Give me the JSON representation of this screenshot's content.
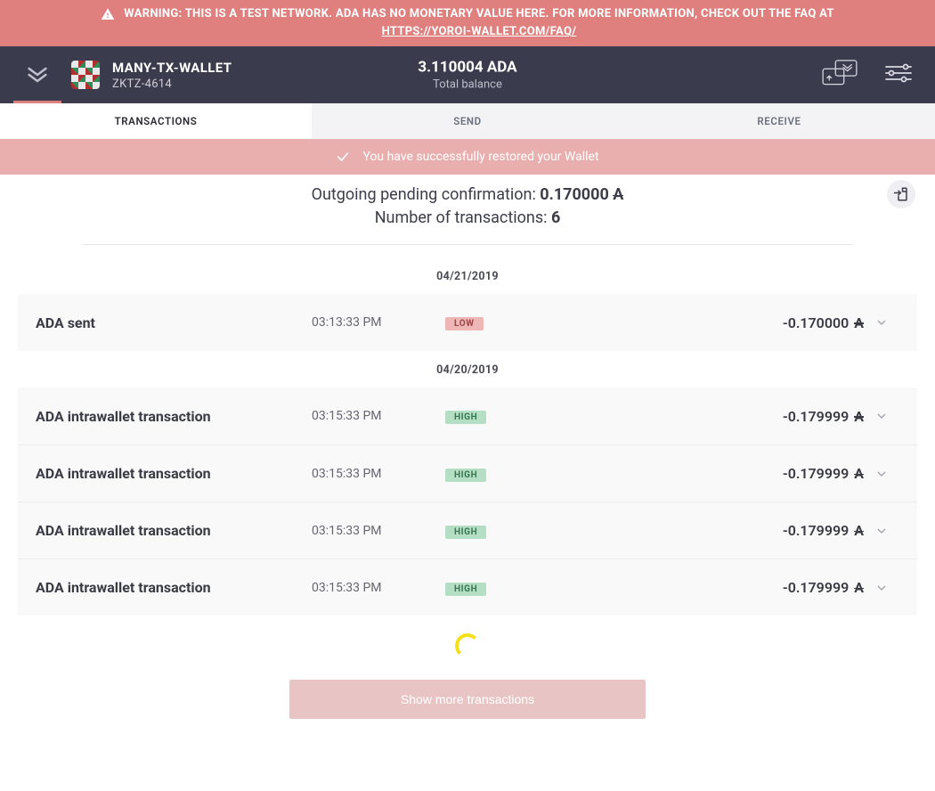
{
  "warning": {
    "prefix": "WARNING: THIS IS A TEST NETWORK. ADA HAS NO MONETARY VALUE HERE. FOR MORE INFORMATION, CHECK OUT THE FAQ AT",
    "faq_url_label": "HTTPS://YOROI-WALLET.COM/FAQ/"
  },
  "wallet": {
    "name": "MANY-TX-WALLET",
    "id": "ZKTZ-4614"
  },
  "balance": {
    "amount": "3.110004 ADA",
    "label": "Total balance"
  },
  "tabs": {
    "transactions": "TRANSACTIONS",
    "send": "SEND",
    "receive": "RECEIVE"
  },
  "success_message": "You have successfully restored your Wallet",
  "summary": {
    "pending_label": "Outgoing pending confirmation:",
    "pending_value": "0.170000",
    "count_label": "Number of transactions:",
    "count_value": "6"
  },
  "badges": {
    "low": "LOW",
    "high": "HIGH"
  },
  "dates": {
    "d1": "04/21/2019",
    "d2": "04/20/2019"
  },
  "tx": {
    "d1_0": {
      "title": "ADA sent",
      "time": "03:13:33 PM",
      "level": "low",
      "amount": "-0.170000"
    },
    "d2_0": {
      "title": "ADA intrawallet transaction",
      "time": "03:15:33 PM",
      "level": "high",
      "amount": "-0.179999"
    },
    "d2_1": {
      "title": "ADA intrawallet transaction",
      "time": "03:15:33 PM",
      "level": "high",
      "amount": "-0.179999"
    },
    "d2_2": {
      "title": "ADA intrawallet transaction",
      "time": "03:15:33 PM",
      "level": "high",
      "amount": "-0.179999"
    },
    "d2_3": {
      "title": "ADA intrawallet transaction",
      "time": "03:15:33 PM",
      "level": "high",
      "amount": "-0.179999"
    }
  },
  "show_more_label": "Show more transactions"
}
